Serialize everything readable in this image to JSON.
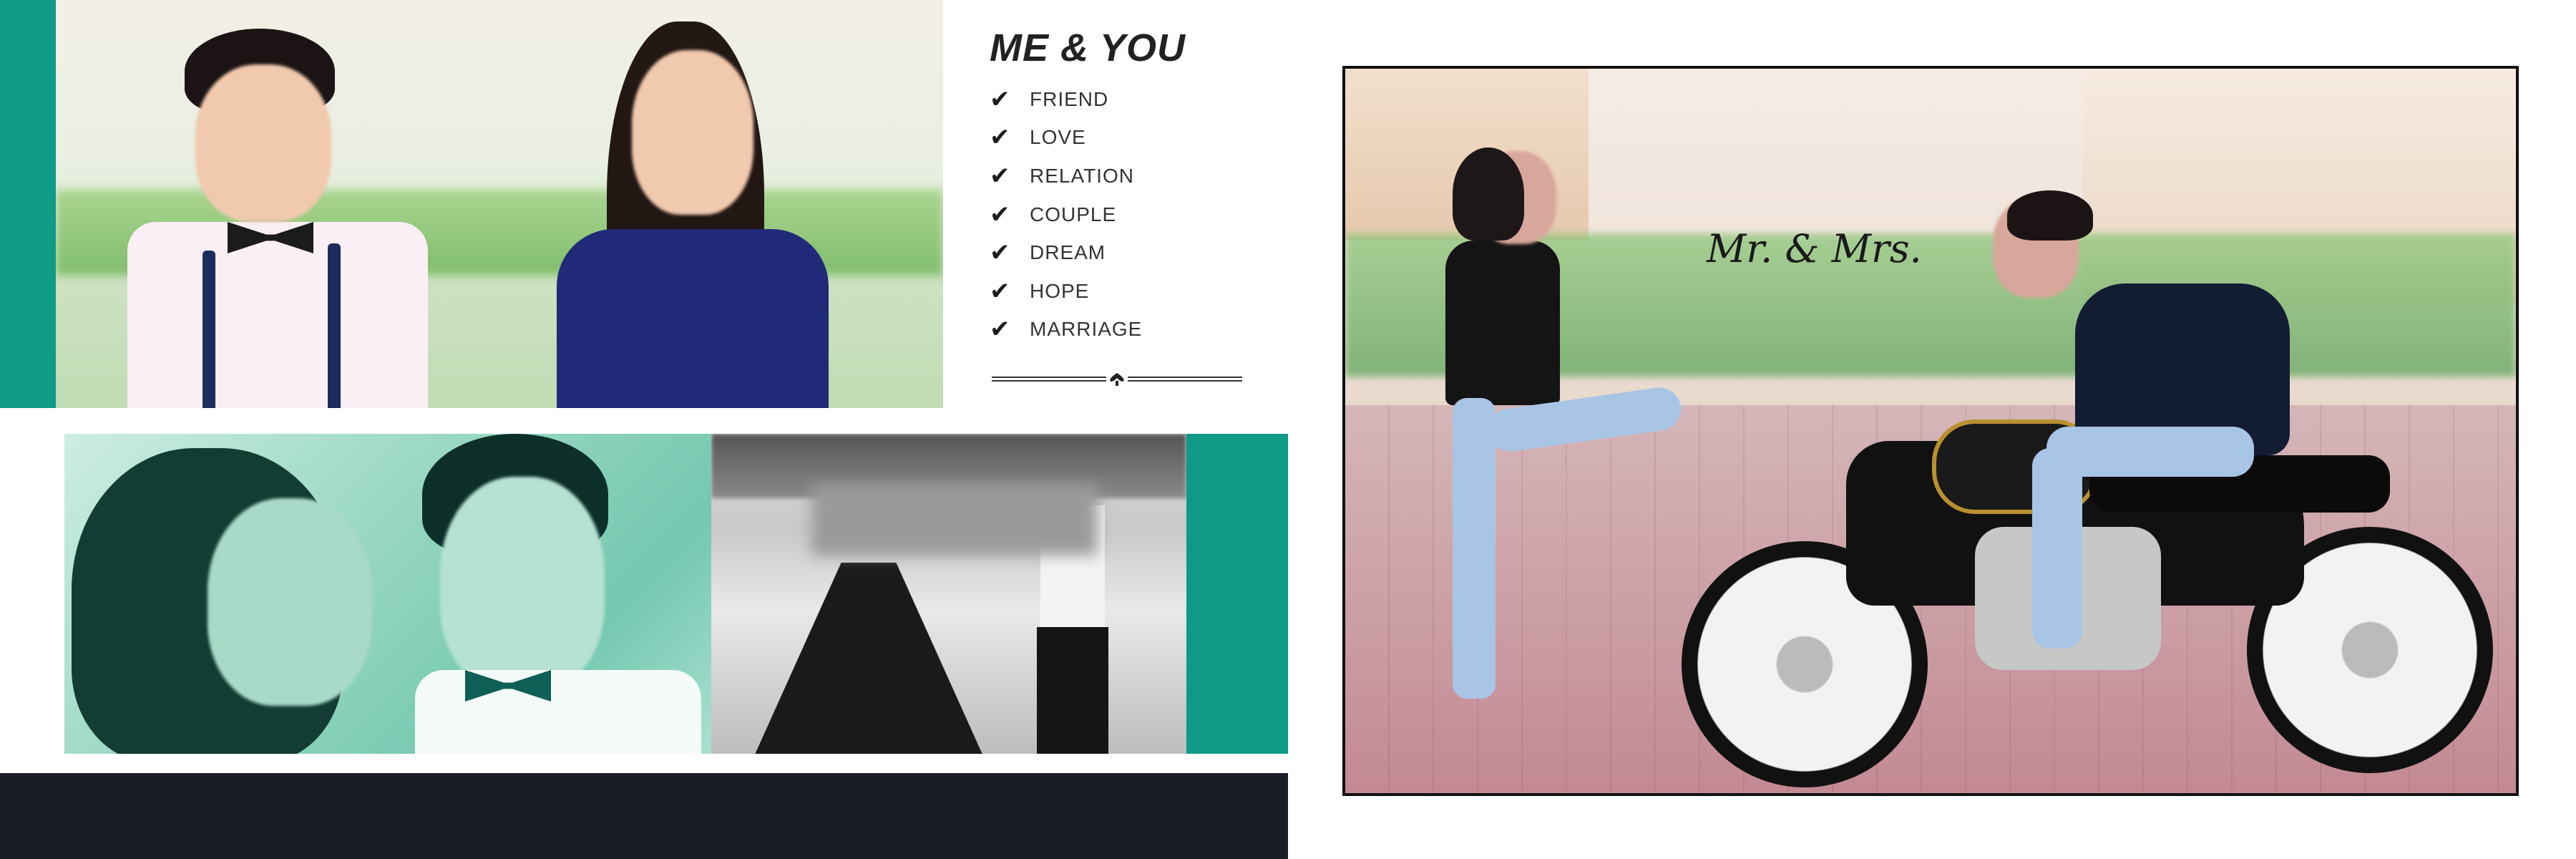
{
  "collage": {
    "title": "ME & YOU",
    "items": [
      {
        "label": "FRIEND"
      },
      {
        "label": "LOVE"
      },
      {
        "label": "RELATION"
      },
      {
        "label": "COUPLE"
      },
      {
        "label": "DREAM"
      },
      {
        "label": "HOPE"
      },
      {
        "label": "MARRIAGE"
      }
    ],
    "check_icon": "check-icon",
    "accent_color": "#0f9a86",
    "footer_color": "#191d26"
  },
  "photo_right": {
    "caption": "Mr. & Mrs."
  }
}
